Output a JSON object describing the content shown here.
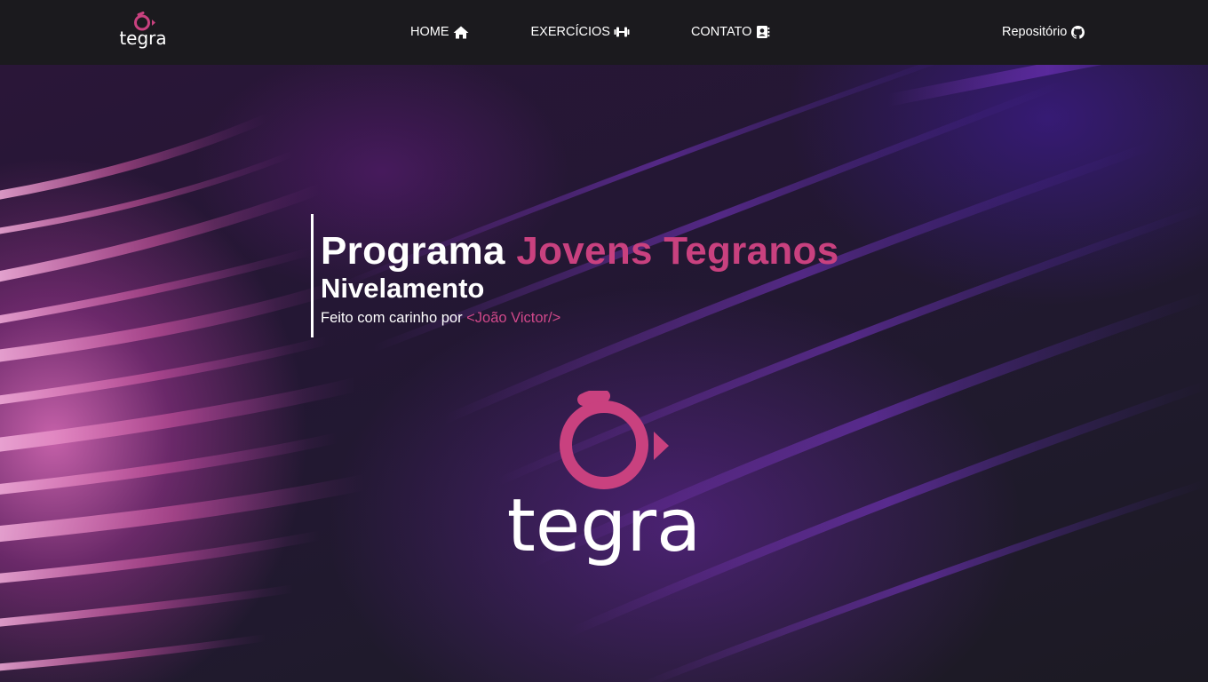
{
  "brand": {
    "name": "tegra",
    "colors": {
      "accent": "#c9417f",
      "navbar_bg": "#1b1a1e",
      "text": "#ffffff"
    }
  },
  "nav": {
    "logo_icon": "tegra-logo",
    "links": [
      {
        "label": "HOME",
        "icon": "home-icon"
      },
      {
        "label": "EXERCÍCIOS",
        "icon": "dumbbell-icon"
      },
      {
        "label": "CONTATO",
        "icon": "address-book-icon"
      }
    ],
    "repo": {
      "label": "Repositório",
      "icon": "github-icon"
    }
  },
  "hero": {
    "title_main": "Programa",
    "title_accent": "Jovens Tegranos",
    "subtitle": "Nivelamento",
    "credit_prefix": "Feito com carinho por",
    "credit_author": "<João Victor/>",
    "logo_text": "tegra"
  }
}
